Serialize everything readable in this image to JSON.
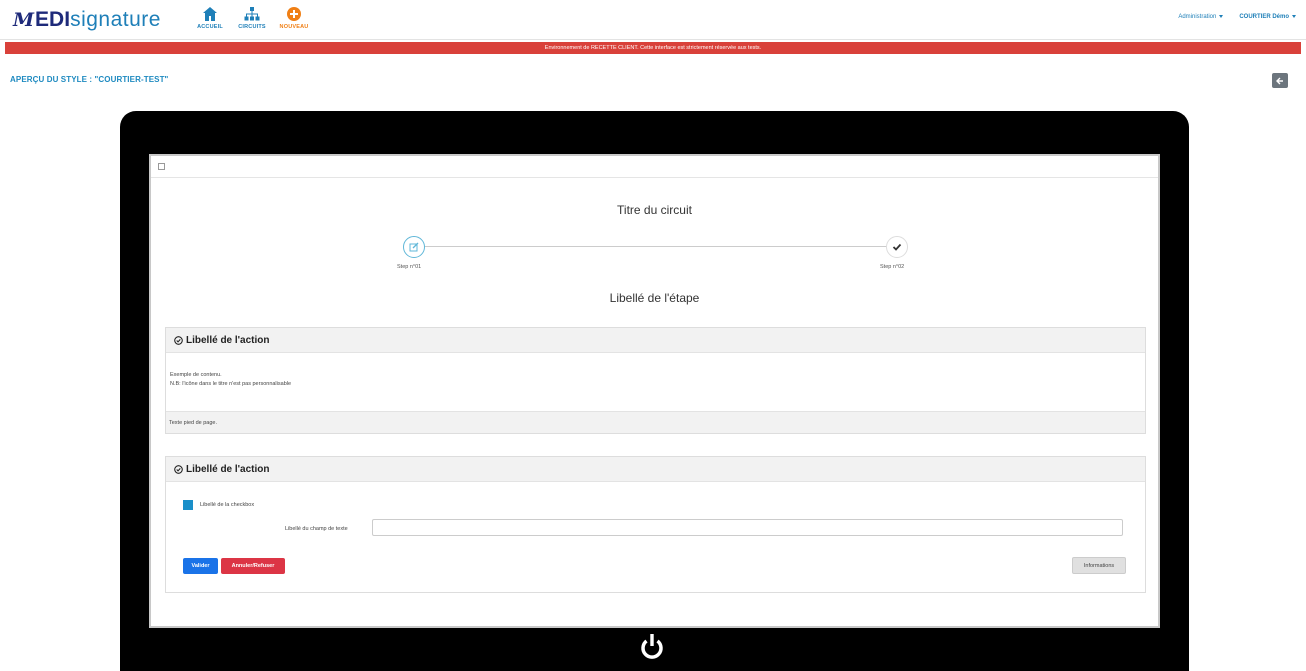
{
  "nav": {
    "brand_mark": "M",
    "brand_edi": "EDI",
    "brand_signature": "signature",
    "links": [
      {
        "label": "ACCUEIL",
        "icon": "home-icon"
      },
      {
        "label": "CIRCUITS",
        "icon": "sitemap-icon"
      },
      {
        "label": "NOUVEAU",
        "icon": "plus-circle-icon"
      }
    ],
    "admin_label": "Administration",
    "user_label": "COURTIER Démo"
  },
  "env_banner": "Environnement de RECETTE CLIENT. Cette interface est strictement réservée aux tests.",
  "page_title": "APERÇU DU STYLE : \"COURTIER-TEST\"",
  "preview": {
    "circuit_title": "Titre du circuit",
    "steps": [
      {
        "label": "Step n°01",
        "icon": "edit-icon"
      },
      {
        "label": "Step n°02",
        "icon": "check-icon"
      }
    ],
    "step_title": "Libellé de l'étape",
    "card1": {
      "title": "Libellé de l'action",
      "content_line1": "Exemple de contenu.",
      "content_line2": "N.B: l'icône dans le titre n'est pas personnalisable",
      "footer": "Texte pied de page."
    },
    "card2": {
      "title": "Libellé de l'action",
      "checkbox_label": "Libellé de la checkbox",
      "textfield_label": "Libellé du champ de texte",
      "textfield_value": "",
      "btn_validate": "Valider",
      "btn_cancel": "Annuler/Refuser",
      "btn_info": "Informations"
    }
  },
  "colors": {
    "brand_dark": "#1e2a7a",
    "brand_blue": "#1e7fb8",
    "nav_orange": "#f07f15",
    "banner_red": "#d9413a",
    "validate_blue": "#1a73e8",
    "cancel_red": "#dc3545"
  }
}
